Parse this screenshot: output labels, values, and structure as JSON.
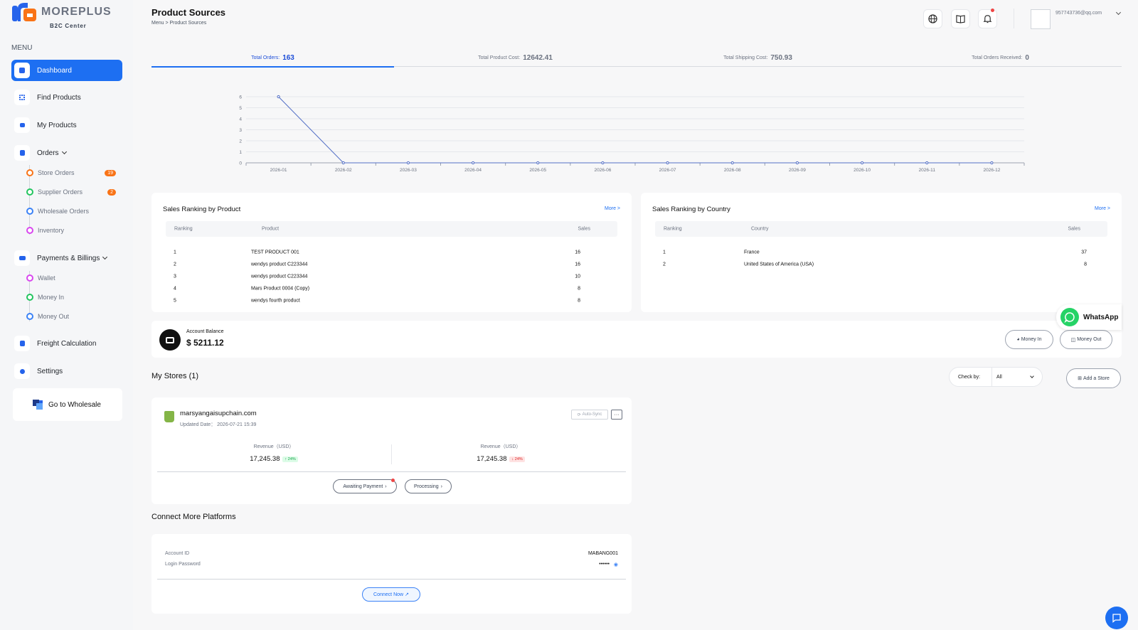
{
  "brand": {
    "name": "MOREPLUS",
    "subtitle": "B2C Center"
  },
  "sidebar": {
    "menu_label": "MENU",
    "items": [
      {
        "label": "Dashboard"
      },
      {
        "label": "Find Products"
      },
      {
        "label": "My Products"
      },
      {
        "label": "Orders"
      },
      {
        "label": "Payments & Billings"
      },
      {
        "label": "Freight Calculation"
      },
      {
        "label": "Settings"
      }
    ],
    "orders_sub": [
      {
        "label": "Store Orders",
        "badge": "19",
        "color": "#f97316"
      },
      {
        "label": "Supplier Orders",
        "badge": "2",
        "color": "#22c55e"
      },
      {
        "label": "Wholesale Orders",
        "badge": "",
        "color": "#3b82f6"
      },
      {
        "label": "Inventory",
        "badge": "",
        "color": "#d946ef"
      }
    ],
    "payments_sub": [
      {
        "label": "Wallet",
        "color": "#d946ef"
      },
      {
        "label": "Money In",
        "color": "#22c55e"
      },
      {
        "label": "Money Out",
        "color": "#3b82f6"
      }
    ],
    "wholesale_button": "Go to Wholesale"
  },
  "header": {
    "title": "Product Sources",
    "breadcrumb": "Menu  >  Product Sources",
    "user_email": "957743736@qq.com"
  },
  "stats": [
    {
      "label": "Total Orders:",
      "value": "163"
    },
    {
      "label": "Total Product Cost:",
      "value": "12642.41"
    },
    {
      "label": "Total Shipping Cost:",
      "value": "750.93"
    },
    {
      "label": "Total Orders Received:",
      "value": "0"
    }
  ],
  "chart_data": {
    "type": "line",
    "x": [
      "2026-01",
      "2026-02",
      "2026-03",
      "2026-04",
      "2026-05",
      "2026-06",
      "2026-07",
      "2026-08",
      "2026-09",
      "2026-10",
      "2026-11",
      "2026-12"
    ],
    "series": [
      {
        "values": [
          6,
          0,
          0,
          0,
          0,
          0,
          0,
          0,
          0,
          0,
          0,
          0
        ]
      }
    ],
    "yticks": [
      "0",
      "1",
      "2",
      "3",
      "4",
      "5",
      "6"
    ],
    "ylim": [
      0,
      6
    ],
    "grid": true,
    "color": "#5470c6"
  },
  "rank_product": {
    "title": "Sales Ranking by Product",
    "more": "More >",
    "headers": [
      "Ranking",
      "Product",
      "Sales"
    ],
    "rows": [
      [
        "1",
        "TEST PRODUCT 001",
        "16"
      ],
      [
        "2",
        "wendys product C223344",
        "16"
      ],
      [
        "3",
        "wendys product C223344",
        "10"
      ],
      [
        "4",
        "Mars Product 0004 (Copy)",
        "8"
      ],
      [
        "5",
        "wendys fourth product",
        "8"
      ]
    ]
  },
  "rank_country": {
    "title": "Sales Ranking by Country",
    "more": "More >",
    "headers": [
      "Ranking",
      "Country",
      "Sales"
    ],
    "rows": [
      [
        "1",
        "France",
        "37"
      ],
      [
        "2",
        "United States of America (USA)",
        "8"
      ]
    ]
  },
  "balance": {
    "label": "Account Balance",
    "value": "$ 5211.12",
    "money_in": "Money In",
    "money_out": "Money Out"
  },
  "stores": {
    "title": "My Stores (1)",
    "check_by_label": "Check by:",
    "check_by_value": "All",
    "add_store": "Add a Store",
    "store": {
      "name": "marsyangaisupchain.com",
      "updated": "Updated Date： 2026-07-21 15:39",
      "auto_sync": "Auto-Sync",
      "more": "···",
      "revenue_label_1": "Revenue（USD）",
      "revenue_value_1": "17,245.38",
      "trend_1": "↑ 24%",
      "revenue_label_2": "Revenue（USD）",
      "revenue_value_2": "17,245.38",
      "trend_2": "↓ 24%",
      "awaiting": "Awaiting Payment",
      "processing": "Processing"
    }
  },
  "connect": {
    "title": "Connect More Platforms",
    "account_id_label": "Account ID",
    "account_id": "MABANG001",
    "password_label": "Login Password",
    "password": "••••••",
    "button": "Connect Now"
  },
  "whatsapp": "WhatsApp"
}
